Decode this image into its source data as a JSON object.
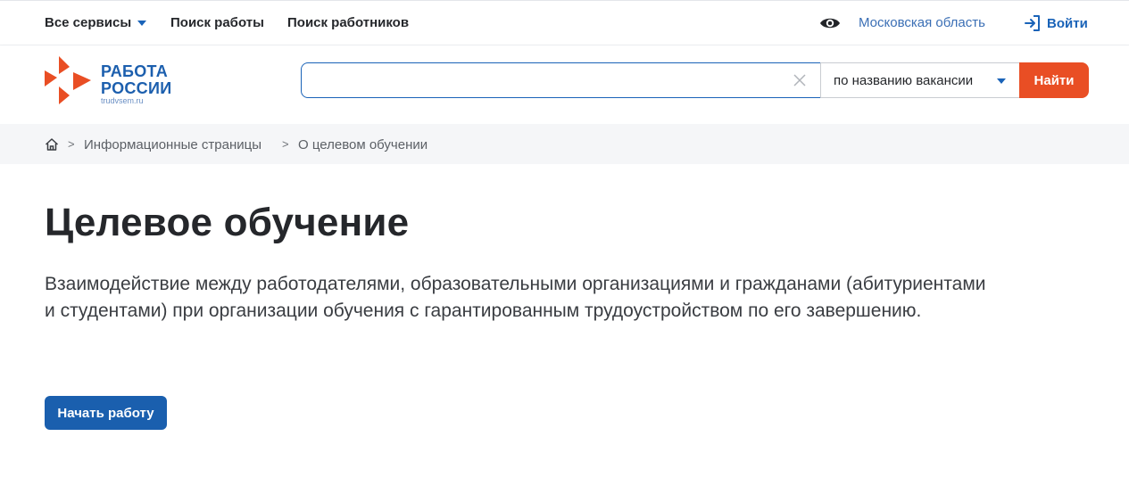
{
  "topnav": {
    "all_services": "Все сервисы",
    "job_search": "Поиск работы",
    "worker_search": "Поиск работников",
    "region": "Московская область",
    "login": "Войти"
  },
  "logo": {
    "line1": "РАБОТА",
    "line2": "РОССИИ",
    "domain": "trudvsem.ru"
  },
  "search": {
    "value": "",
    "placeholder": "",
    "mode": "по названию вакансии",
    "submit": "Найти"
  },
  "breadcrumb": {
    "separator": ">",
    "items": [
      "Информационные страницы",
      "О целевом обучении"
    ]
  },
  "main": {
    "title": "Целевое обучение",
    "description": "Взаимодействие между работодателями, образовательными организациями и гражданами (абитуриентами и студентами) при организации обучения с гарантированным трудоустройством по его завершению.",
    "cta": "Начать работу"
  },
  "colors": {
    "brand_blue": "#1a5fae",
    "accent_orange": "#e94e24",
    "breadcrumb_bg": "#f5f6f8"
  },
  "icons": [
    "eye-icon",
    "login-icon",
    "close-icon",
    "chevron-down-icon",
    "home-icon",
    "logo-mark"
  ]
}
